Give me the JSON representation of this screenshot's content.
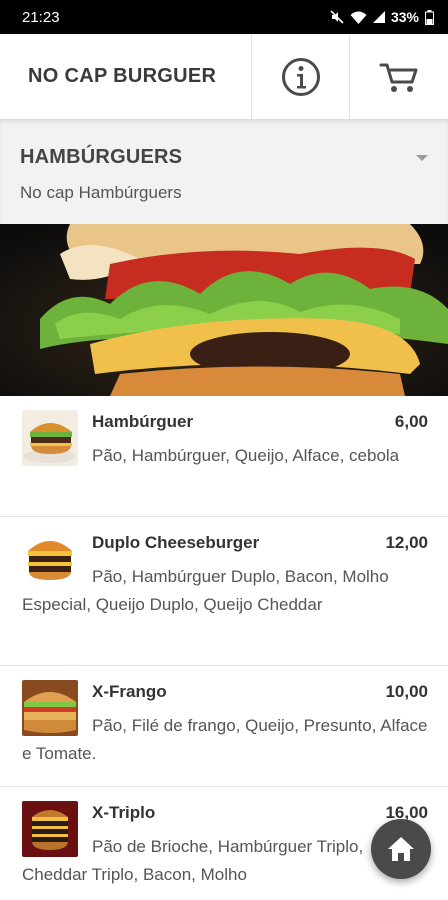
{
  "status_bar": {
    "time": "21:23",
    "battery": "33%"
  },
  "header": {
    "title": "NO CAP BURGUER",
    "info_icon": "info-icon",
    "cart_icon": "cart-icon"
  },
  "category": {
    "title": "HAMBÚRGUERS",
    "subtitle": "No cap Hambúrguers"
  },
  "products": [
    {
      "name": "Hambúrguer",
      "price": "6,00",
      "description": "Pão, Hambúrguer, Queijo, Alface, cebola"
    },
    {
      "name": "Duplo Cheeseburger",
      "price": "12,00",
      "description": "Pão, Hambúrguer Duplo, Bacon, Molho Especial, Queijo Duplo, Queijo Cheddar"
    },
    {
      "name": "X-Frango",
      "price": "10,00",
      "description": "Pão, Filé de frango, Queijo, Presunto, Alface e Tomate."
    },
    {
      "name": "X-Triplo",
      "price": "16,00",
      "description": "Pão de Brioche, Hambúrguer Triplo, Cheddar Triplo, Bacon, Molho"
    }
  ],
  "fab": {
    "icon": "home-icon"
  },
  "colors": {
    "status_bar": "#000000",
    "category_bg": "#f2f2f2",
    "fab": "#4a4a4a",
    "text": "#333333"
  }
}
